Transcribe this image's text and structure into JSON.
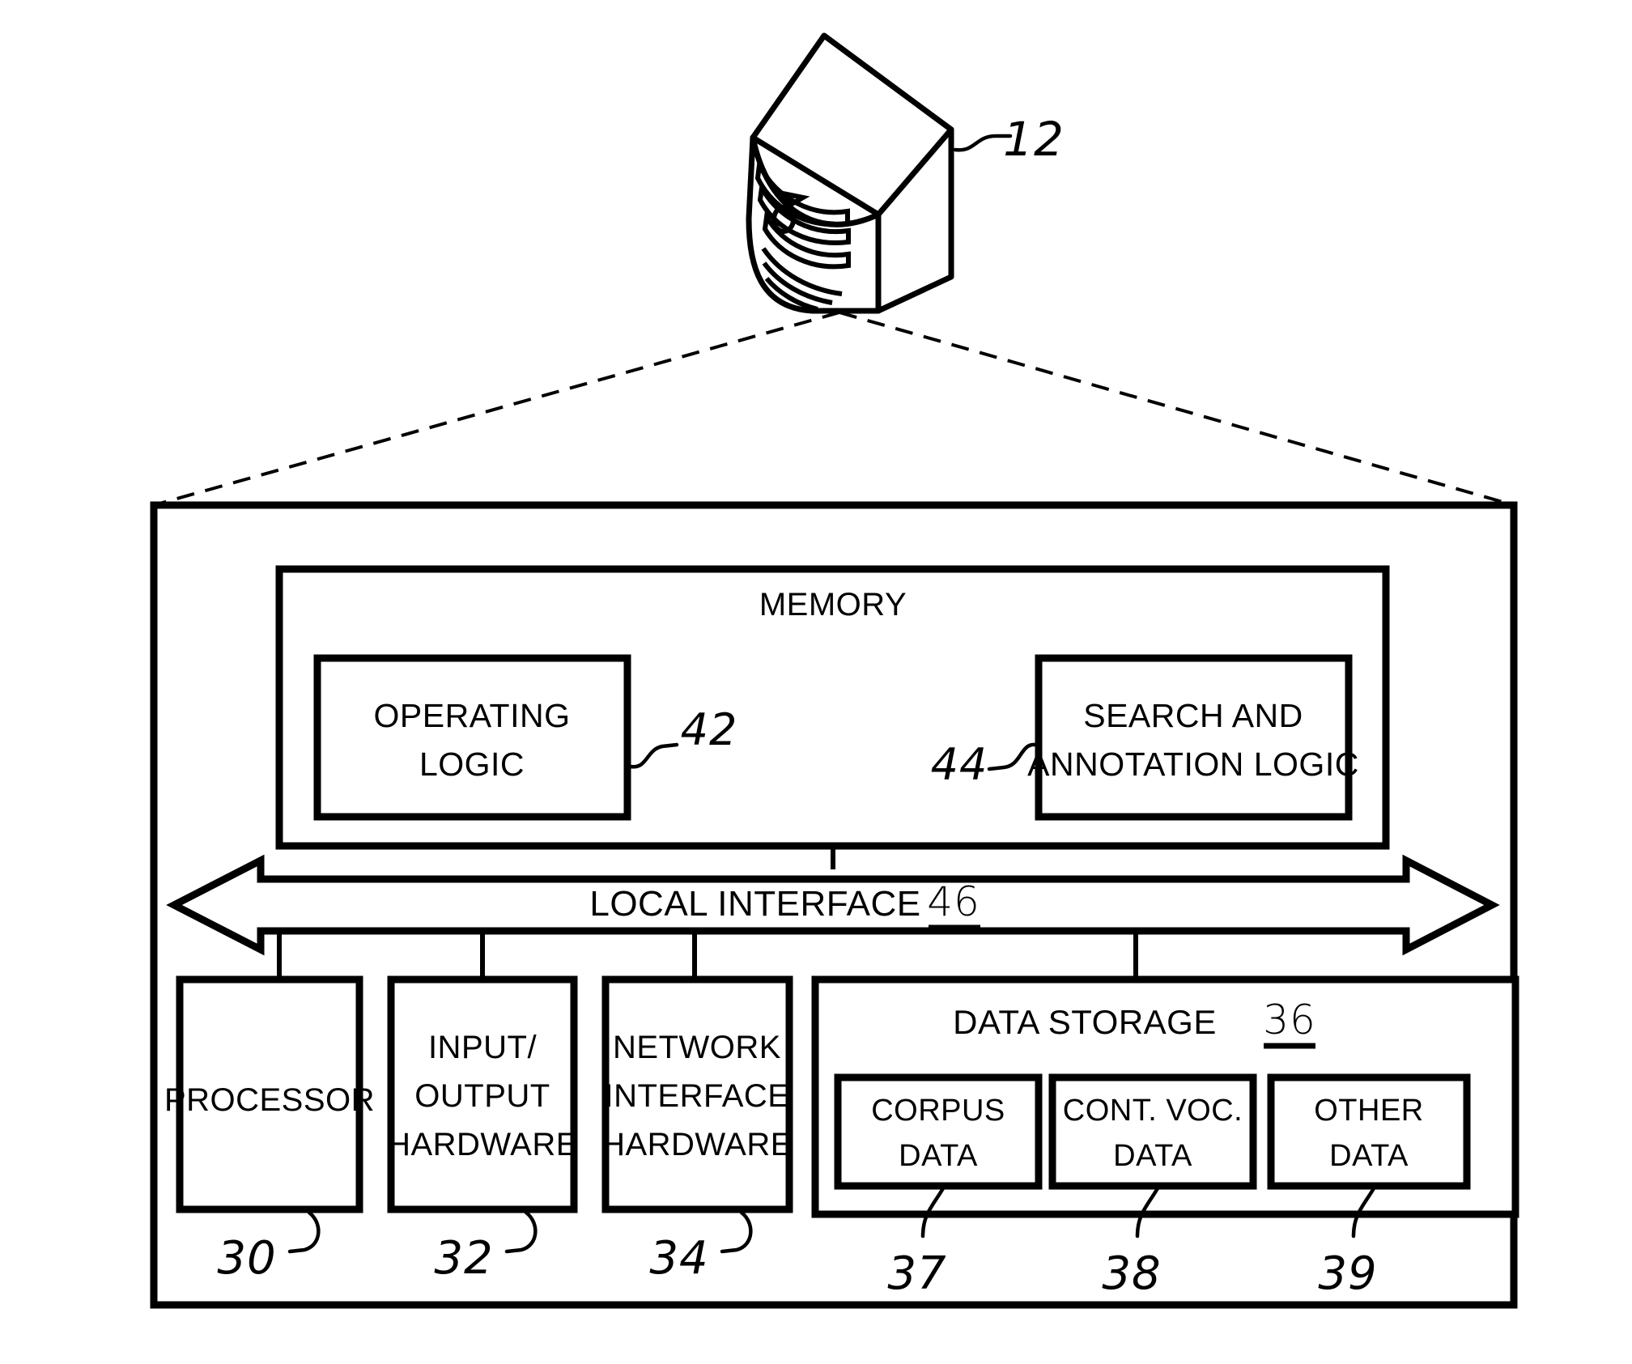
{
  "figure": {
    "type": "patent-block-diagram",
    "background": "#ffffff",
    "line_color": "#000000"
  },
  "server": {
    "icon_name": "server-tower-icon",
    "ref": "12"
  },
  "system_frame": {
    "ref_shown": false
  },
  "memory": {
    "title": "MEMORY",
    "blocks": [
      {
        "label_line1": "OPERATING",
        "label_line2": "LOGIC",
        "ref": "42"
      },
      {
        "label_line1": "SEARCH AND",
        "label_line2": "ANNOTATION LOGIC",
        "ref": "44"
      }
    ]
  },
  "bus": {
    "label": "LOCAL INTERFACE",
    "ref": "46"
  },
  "components": [
    {
      "name": "processor",
      "lines": [
        "PROCESSOR"
      ],
      "ref": "30"
    },
    {
      "name": "input-output-hardware",
      "lines": [
        "INPUT/",
        "OUTPUT",
        "HARDWARE"
      ],
      "ref": "32"
    },
    {
      "name": "network-interface-hardware",
      "lines": [
        "NETWORK",
        "INTERFACE",
        "HARDWARE"
      ],
      "ref": "34"
    }
  ],
  "data_storage": {
    "title": "DATA STORAGE",
    "ref": "36",
    "blocks": [
      {
        "name": "corpus-data",
        "line1": "CORPUS",
        "line2": "DATA",
        "ref": "37"
      },
      {
        "name": "controlled-vocabulary-data",
        "line1": "CONT. VOC.",
        "line2": "DATA",
        "ref": "38"
      },
      {
        "name": "other-data",
        "line1": "OTHER",
        "line2": "DATA",
        "ref": "39"
      }
    ]
  }
}
